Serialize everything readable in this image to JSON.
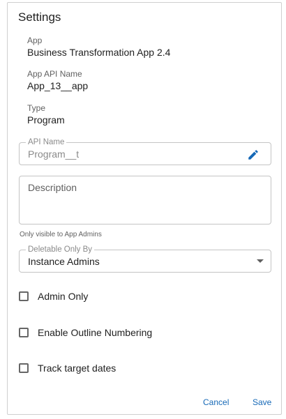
{
  "settings": {
    "title": "Settings",
    "app": {
      "label": "App",
      "value": "Business Transformation App 2.4"
    },
    "app_api_name": {
      "label": "App API Name",
      "value": "App_13__app"
    },
    "type": {
      "label": "Type",
      "value": "Program"
    },
    "api_name_field": {
      "label": "API Name",
      "value": "Program__t",
      "icon": "pencil-edit-icon"
    },
    "description_field": {
      "placeholder": "Description",
      "helper": "Only visible to App Admins"
    },
    "deletable_field": {
      "label": "Deletable Only By",
      "value": "Instance Admins",
      "icon": "dropdown-caret-icon"
    },
    "checkboxes": [
      {
        "label": "Admin Only",
        "checked": false
      },
      {
        "label": "Enable Outline Numbering",
        "checked": false
      },
      {
        "label": "Track target dates",
        "checked": false
      }
    ],
    "actions": {
      "cancel": "Cancel",
      "save": "Save"
    }
  },
  "colors": {
    "accent": "#1669b7",
    "border": "#c4c4c4",
    "muted": "#8a8a8a"
  }
}
